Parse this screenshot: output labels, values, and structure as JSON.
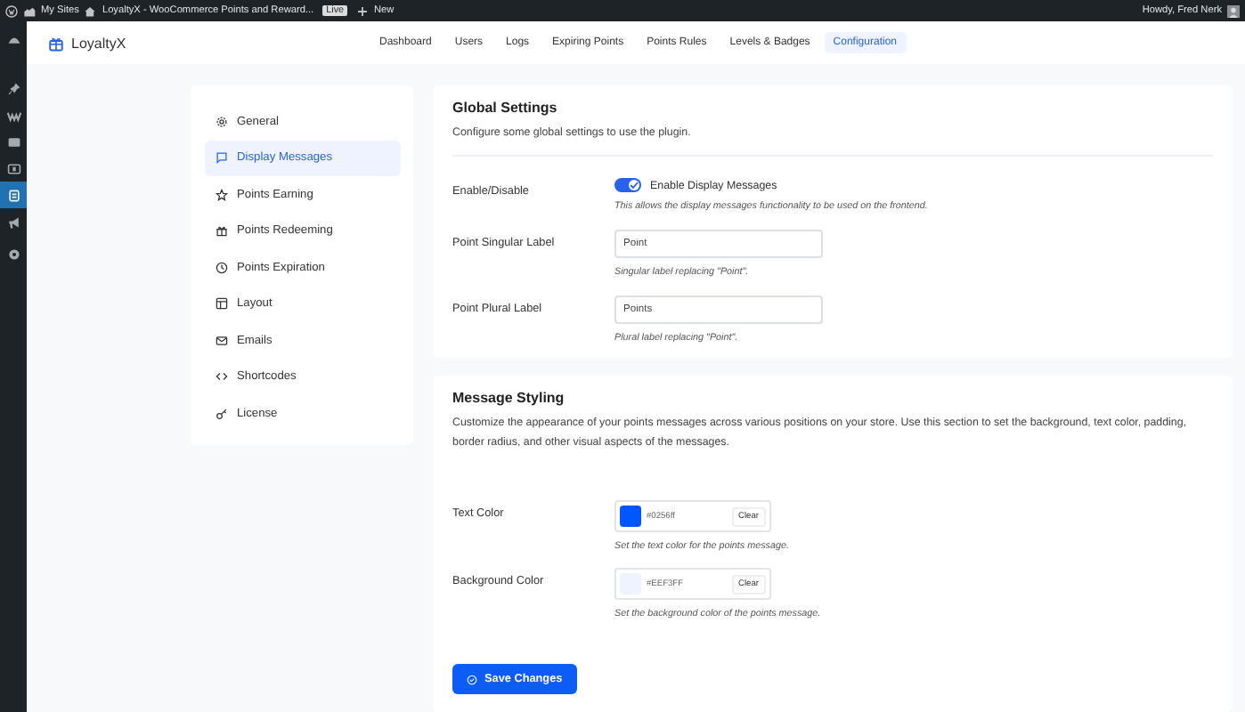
{
  "admin_bar": {
    "sites": "My Sites",
    "site_name": "LoyaltyX - WooCommerce Points and Reward...",
    "badge": "Live",
    "new": "New",
    "greeting": "Howdy, Fred Nerk"
  },
  "admin_menu": [
    {
      "selected": false
    },
    {
      "selected": false
    },
    {
      "selected": false
    },
    {
      "selected": false
    },
    {
      "selected": false
    },
    {
      "selected": true
    },
    {
      "selected": false
    },
    {
      "selected": false
    }
  ],
  "header": {
    "brand": "LoyaltyX",
    "nav": [
      {
        "label": "Dashboard",
        "selected": false
      },
      {
        "label": "Users",
        "selected": false
      },
      {
        "label": "Logs",
        "selected": false
      },
      {
        "label": "Expiring Points",
        "selected": false
      },
      {
        "label": "Points Rules",
        "selected": false
      },
      {
        "label": "Levels & Badges",
        "selected": false
      },
      {
        "label": "Configuration",
        "selected": true
      }
    ]
  },
  "settings_nav": [
    {
      "label": "General",
      "selected": false
    },
    {
      "label": "Display Messages",
      "selected": true
    },
    {
      "label": "Points Earning",
      "selected": false
    },
    {
      "label": "Points Redeeming",
      "selected": false
    },
    {
      "label": "Points Expiration",
      "selected": false
    },
    {
      "label": "Layout",
      "selected": false
    },
    {
      "label": "Emails",
      "selected": false
    },
    {
      "label": "Shortcodes",
      "selected": false
    },
    {
      "label": "License",
      "selected": false
    }
  ],
  "sections": [
    {
      "title": "Global Settings",
      "description": "Configure some global settings to use the plugin.",
      "fields": [
        {
          "kind": "toggle",
          "label": "Enable/Disable",
          "on": true,
          "toggle_label": "Enable Display Messages",
          "hint": "This allows the display messages functionality to be used on the frontend."
        },
        {
          "kind": "text",
          "label": "Point Singular Label",
          "value": "Point",
          "hint": "Singular label replacing \"Point\"."
        },
        {
          "kind": "text",
          "label": "Point Plural Label",
          "value": "Points",
          "hint": "Plural label replacing \"Point\"."
        }
      ]
    },
    {
      "title": "Message Styling",
      "description": "Customize the appearance of your points messages across various positions on your store. Use this section to set the background, text color, padding, border radius, and other visual aspects of the messages.",
      "fields": [
        {
          "kind": "color",
          "label": "Text Color",
          "value": "#0256ff",
          "clear": "Clear",
          "hint": "Set the text color for the points message."
        },
        {
          "kind": "color",
          "label": "Background Color",
          "value": "#EEF3FF",
          "clear": "Clear",
          "hint": "Set the background color of the points message."
        }
      ]
    }
  ],
  "save_button": "Save Changes"
}
